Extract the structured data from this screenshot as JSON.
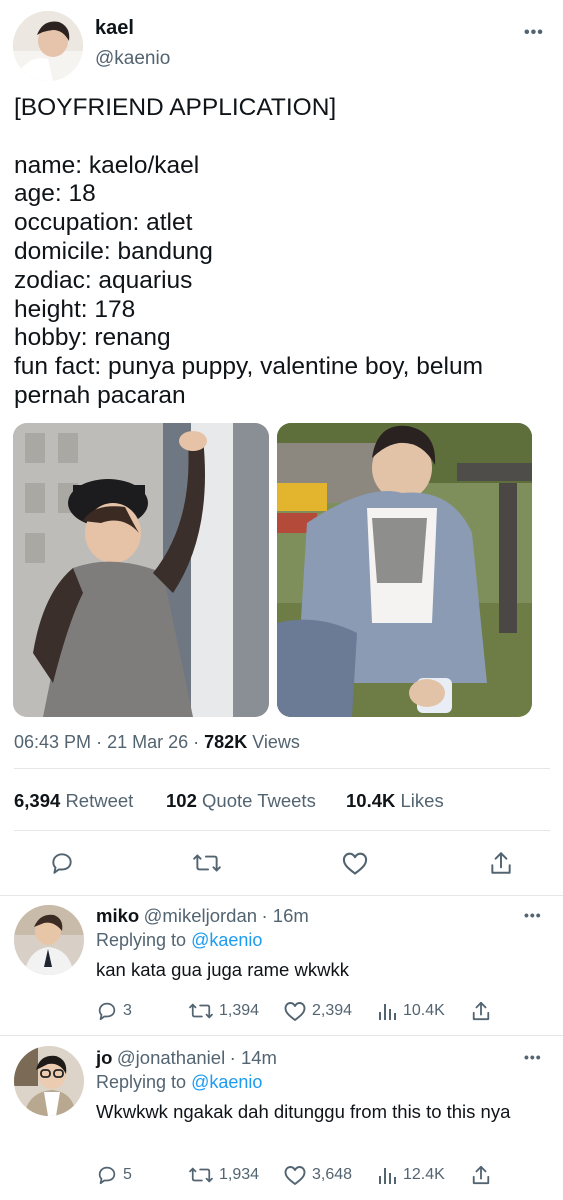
{
  "tweet": {
    "author": {
      "name": "kael",
      "handle": "@kaenio"
    },
    "more_icon": "more-horizontal-icon",
    "text": "[BOYFRIEND APPLICATION]\n\nname: kaelo/kael\nage: 18\noccupation: atlet\ndomicile: bandung\nzodiac: aquarius\nheight: 178\nhobby: renang\nfun fact: punya puppy, valentine boy, belum pernah pacaran",
    "time": "06:43 PM",
    "date": "21 Mar 26",
    "views_count": "782K",
    "views_label": "Views",
    "stats": {
      "retweets": "6,394",
      "retweets_label": "Retweet",
      "quotes": "102",
      "quotes_label": "Quote Tweets",
      "likes": "10.4K",
      "likes_label": "Likes"
    },
    "actions": [
      "reply-icon",
      "retweet-icon",
      "like-icon",
      "share-icon"
    ]
  },
  "replies": [
    {
      "name": "miko",
      "handle": "@mikeljordan",
      "time": "· 16m",
      "replying_label": "Replying to",
      "replying_to": "@kaenio",
      "text": "kan kata gua juga rame wkwkk",
      "reply_count": "3",
      "retweet_count": "1,394",
      "like_count": "2,394",
      "view_count": "10.4K"
    },
    {
      "name": "jo",
      "handle": "@jonathaniel",
      "time": "· 14m",
      "replying_label": "Replying to",
      "replying_to": "@kaenio",
      "text": "Wkwkwk ngakak dah ditunggu from this to this nya",
      "reply_count": "5",
      "retweet_count": "1,934",
      "like_count": "3,648",
      "view_count": "12.4K"
    }
  ]
}
